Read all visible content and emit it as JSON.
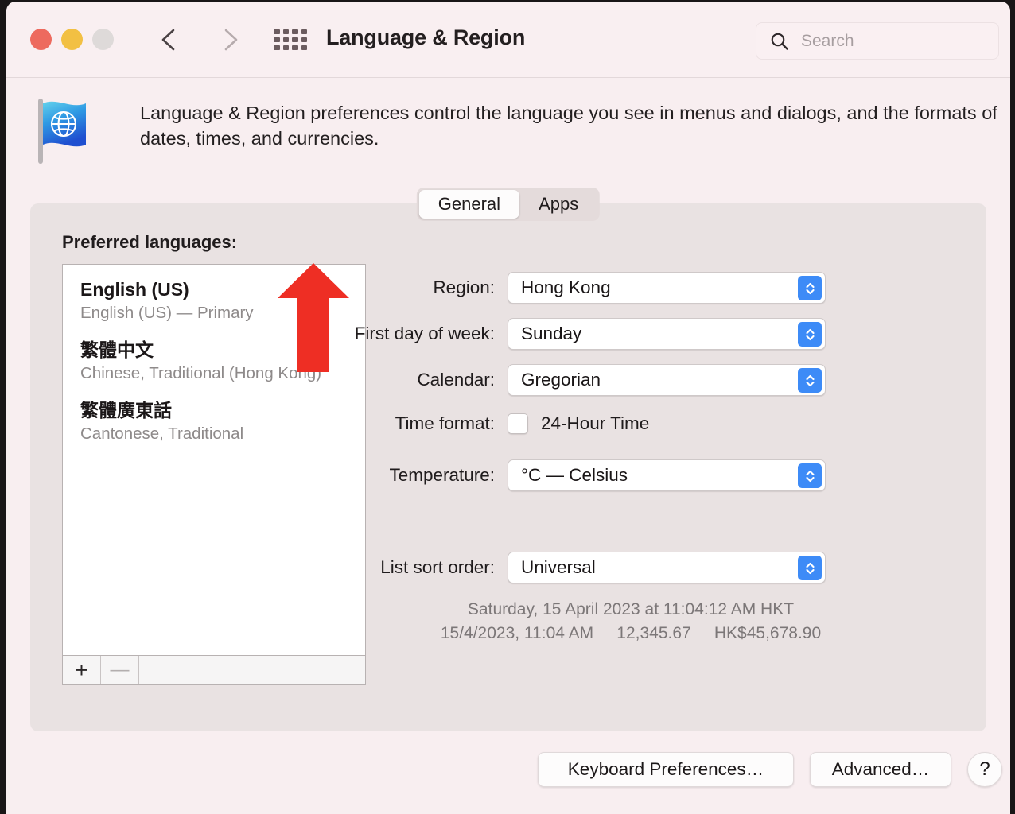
{
  "window": {
    "title": "Language & Region",
    "traffic_lights": [
      {
        "name": "close",
        "color": "#ed6a5e"
      },
      {
        "name": "minimize",
        "color": "#f2c043"
      },
      {
        "name": "zoom",
        "color": "#dedad9"
      }
    ],
    "nav": {
      "back_icon": "chevron-left-icon",
      "forward_icon": "chevron-right-icon"
    },
    "grid_icon": "grid-apps-icon"
  },
  "search": {
    "icon": "search-icon",
    "placeholder": "Search",
    "value": ""
  },
  "header": {
    "icon": "flag-globe-icon",
    "description": "Language & Region preferences control the language you see in menus and dialogs, and the formats of dates, times, and currencies."
  },
  "tabs": [
    {
      "label": "General",
      "selected": true
    },
    {
      "label": "Apps",
      "selected": false
    }
  ],
  "languages": {
    "section_label": "Preferred languages:",
    "items": [
      {
        "name": "English (US)",
        "subtitle": "English (US) — Primary"
      },
      {
        "name": "繁體中文",
        "subtitle": "Chinese, Traditional (Hong Kong)"
      },
      {
        "name": "繁體廣東話",
        "subtitle": "Cantonese, Traditional"
      }
    ],
    "add_label": "+",
    "remove_label": "—"
  },
  "form": {
    "region": {
      "label": "Region:",
      "value": "Hong Kong"
    },
    "first_day": {
      "label": "First day of week:",
      "value": "Sunday"
    },
    "calendar": {
      "label": "Calendar:",
      "value": "Gregorian"
    },
    "time_format": {
      "label": "Time format:",
      "checkbox_label": "24-Hour Time",
      "checked": false
    },
    "temperature": {
      "label": "Temperature:",
      "value": "°C — Celsius"
    },
    "list_sort_order": {
      "label": "List sort order:",
      "value": "Universal"
    }
  },
  "sample": {
    "line1": "Saturday, 15 April 2023 at 11:04:12 AM HKT",
    "line2": "15/4/2023, 11:04 AM     12,345.67     HK$45,678.90"
  },
  "footer": {
    "keyboard_button": "Keyboard Preferences…",
    "advanced_button": "Advanced…",
    "help_button": "?"
  },
  "annotation": {
    "arrow_color": "#ee2e24",
    "arrow_direction": "up"
  },
  "colors": {
    "window_bg": "#f8eef0",
    "panel_bg": "#e9e2e2",
    "accent_blue": "#3d8bf7",
    "annotation_red": "#ee2e24"
  }
}
